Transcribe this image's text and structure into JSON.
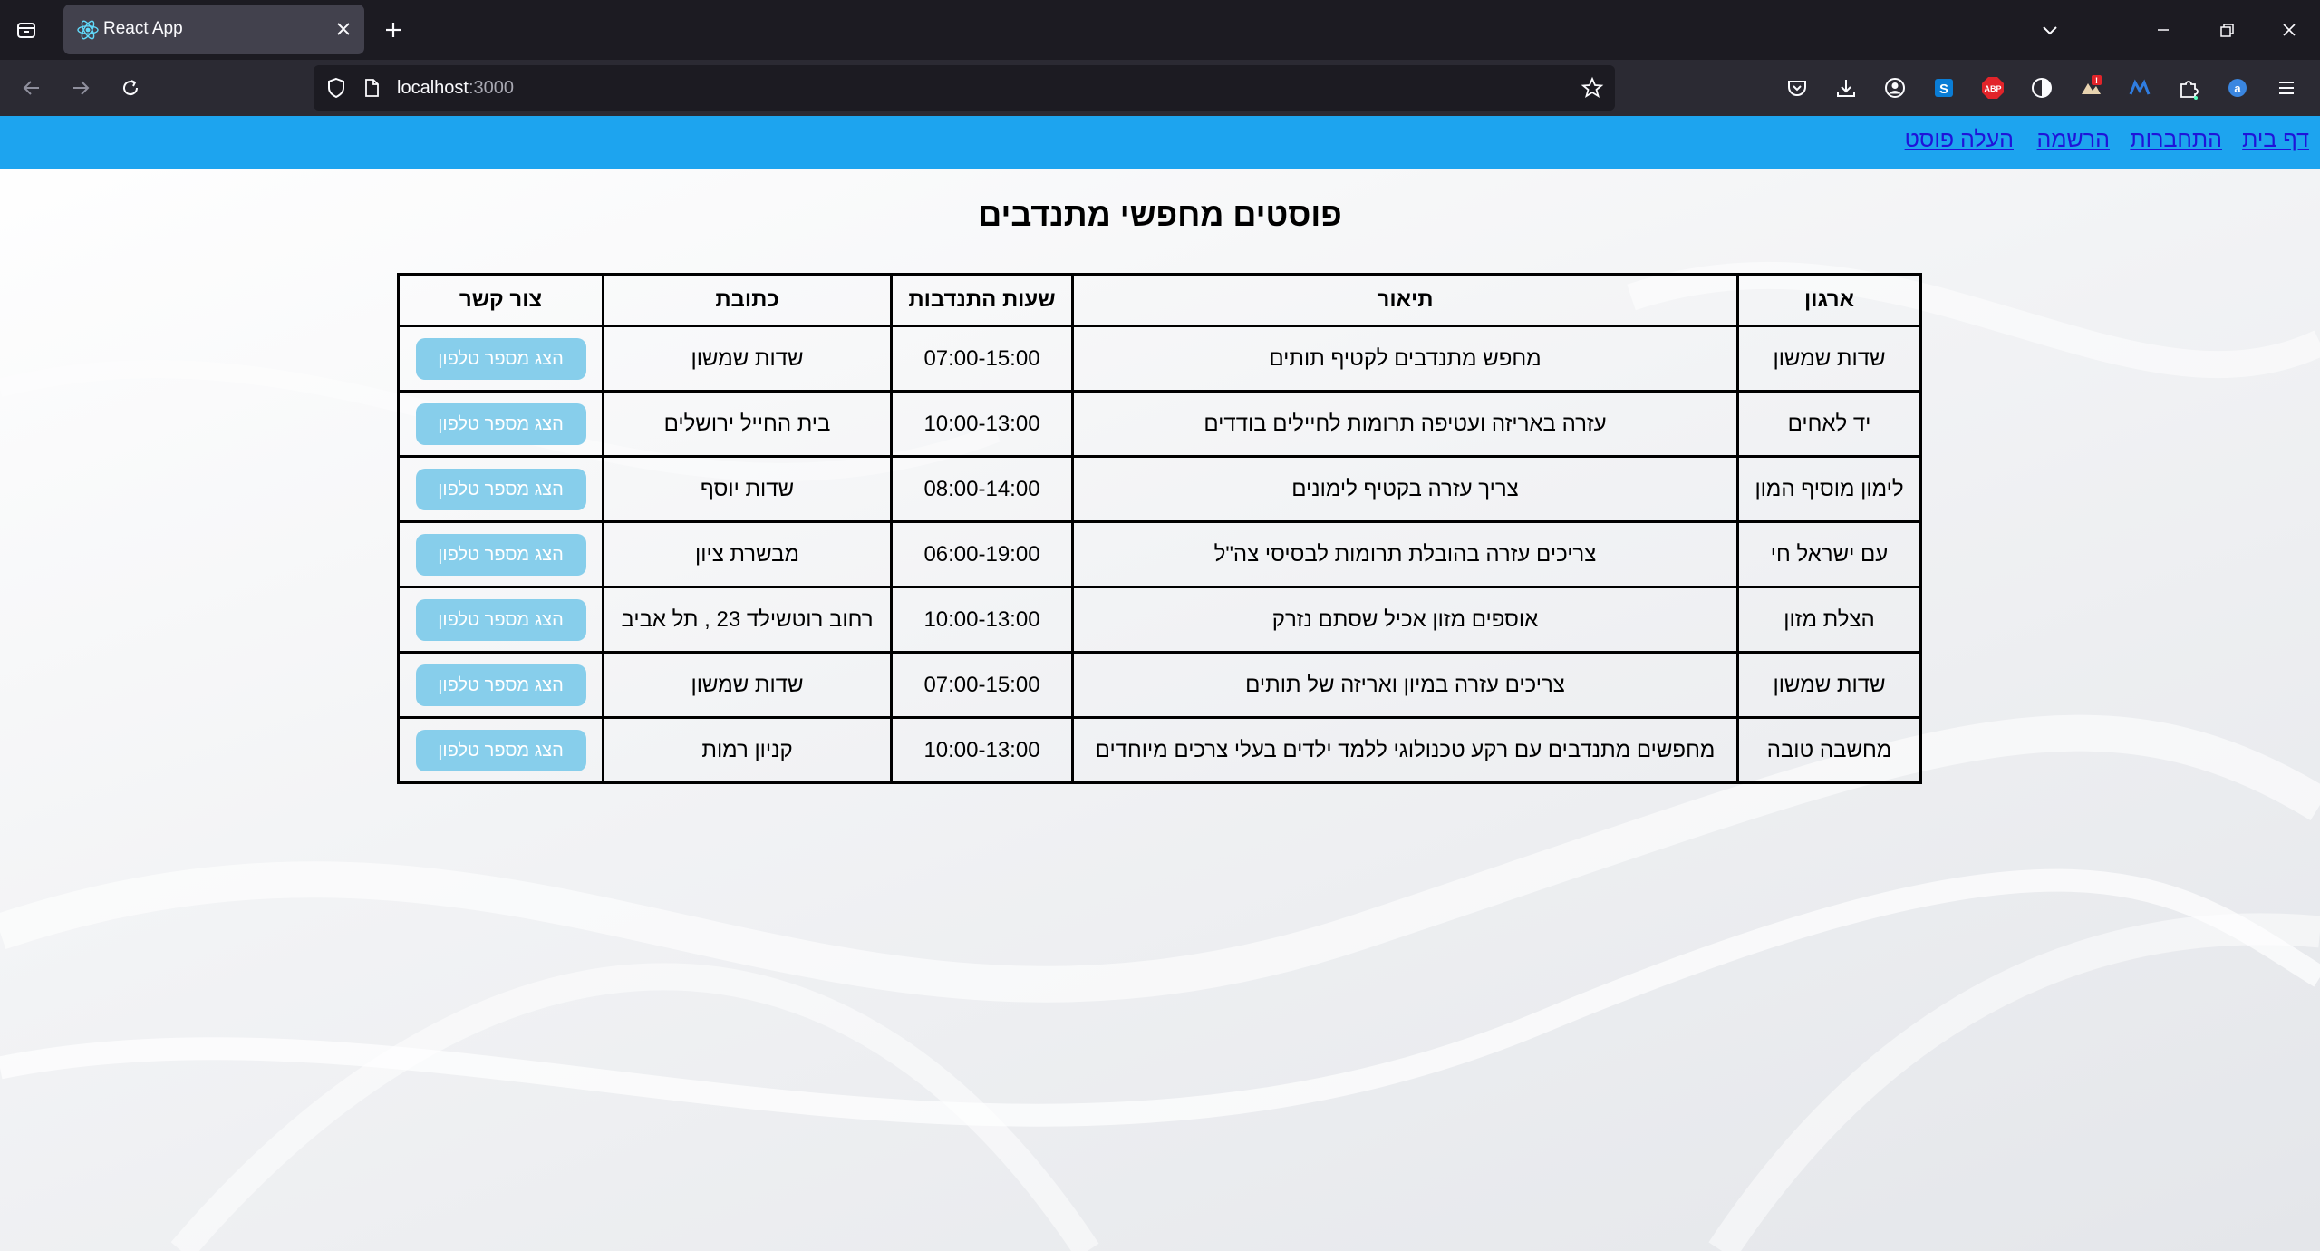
{
  "browser": {
    "tab_title": "React App",
    "url_host": "localhost",
    "url_port": ":3000"
  },
  "site_nav": {
    "items": [
      "דף בית",
      "התחברות",
      "הרשמה",
      "העלה פוסט"
    ]
  },
  "page": {
    "title": "פוסטים מחפשי מתנדבים"
  },
  "table": {
    "headers": [
      "ארגון",
      "תיאור",
      "שעות התנדבות",
      "כתובת",
      "צור קשר"
    ],
    "contact_button_label": "הצג מספר טלפון",
    "rows": [
      {
        "org": "שדות שמשון",
        "desc": "מחפש מתנדבים לקטיף תותים",
        "hours": "07:00-15:00",
        "address": "שדות שמשון"
      },
      {
        "org": "יד לאחים",
        "desc": "עזרה באריזה ועטיפה תרומות לחיילים בודדים",
        "hours": "10:00-13:00",
        "address": "בית החייל ירושלים"
      },
      {
        "org": "לימון מוסיף המון",
        "desc": "צריך עזרה בקטיף לימונים",
        "hours": "08:00-14:00",
        "address": "שדות יוסף"
      },
      {
        "org": "עם ישראל חי",
        "desc": "צריכים עזרה בהובלת תרומות לבסיסי צה\"ל",
        "hours": "06:00-19:00",
        "address": "מבשרת ציון"
      },
      {
        "org": "הצלת מזון",
        "desc": "אוספים מזון אכיל שסתם נזרק",
        "hours": "10:00-13:00",
        "address": "רחוב רוטשילד 23 , תל אביב"
      },
      {
        "org": "שדות שמשון",
        "desc": "צריכים עזרה במיון ואריזה של תותים",
        "hours": "07:00-15:00",
        "address": "שדות שמשון"
      },
      {
        "org": "מחשבה טובה",
        "desc": "מחפשים מתנדבים עם רקע טכנולוגי ללמד ילדים בעלי צרכים מיוחדים",
        "hours": "10:00-13:00",
        "address": "קניון רמות"
      }
    ]
  },
  "colors": {
    "site_nav_bg": "#1da4ef",
    "link": "#1f14d9",
    "button_bg": "#87ceeb"
  }
}
